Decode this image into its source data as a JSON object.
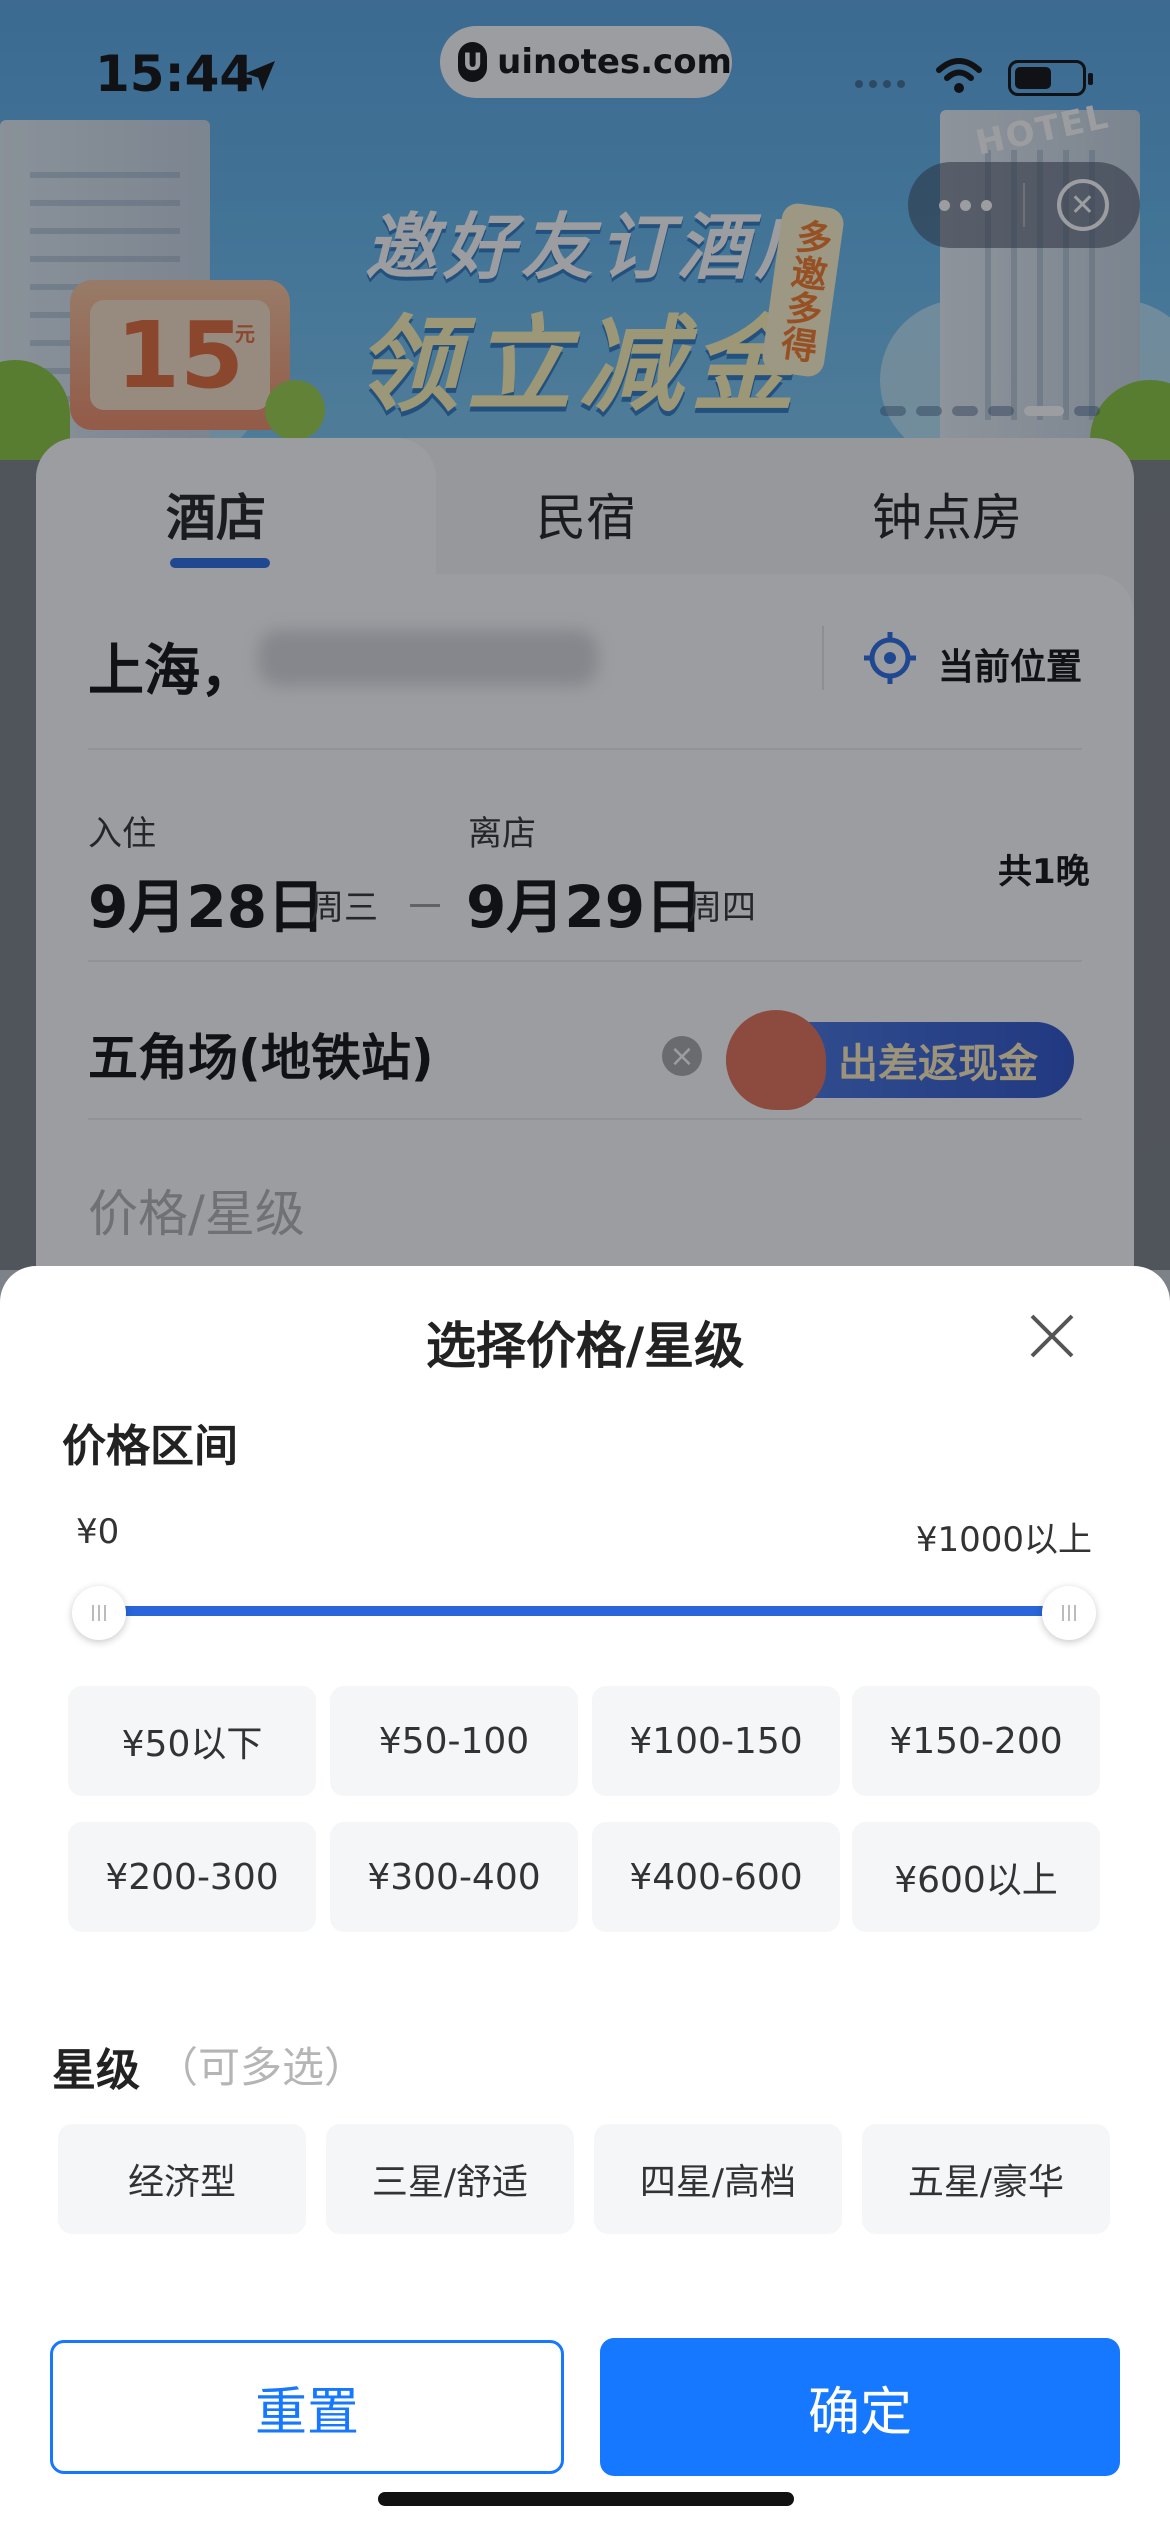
{
  "status_bar": {
    "time": "15:44",
    "url": "uinotes.com",
    "url_logo": "U"
  },
  "banner": {
    "promo_line1": "邀好友订酒店",
    "promo_line2": "领立减金",
    "promo_tag": "多邀多得",
    "coupon_value": "15",
    "coupon_unit": "元",
    "hotel_sign": "HOTEL"
  },
  "capsule": {
    "close_glyph": "✕"
  },
  "tabs": [
    "酒店",
    "民宿",
    "钟点房"
  ],
  "search": {
    "city": "上海，",
    "current_location": "当前位置",
    "checkin_label": "入住",
    "checkin_date": "9月28日",
    "checkin_week": "周三",
    "checkout_label": "离店",
    "checkout_date": "9月29日",
    "checkout_week": "周四",
    "nights": "共1晚",
    "poi": "五角场(地铁站)",
    "cashback_badge": "出差返现金",
    "price_placeholder": "价格/星级"
  },
  "sheet": {
    "title": "选择价格/星级",
    "price_section_title": "价格区间",
    "price_min_label": "¥0",
    "price_max_label": "¥1000以上",
    "slider_range": [
      0,
      1000
    ],
    "price_chips": [
      "¥50以下",
      "¥50-100",
      "¥100-150",
      "¥150-200",
      "¥200-300",
      "¥300-400",
      "¥400-600",
      "¥600以上"
    ],
    "star_section_title": "星级",
    "star_hint": "（可多选）",
    "star_chips": [
      "经济型",
      "三星/舒适",
      "四星/高档",
      "五星/豪华"
    ],
    "reset_label": "重置",
    "confirm_label": "确定"
  },
  "colors": {
    "accent": "#1677ff",
    "slider": "#2a65d9",
    "chip_bg": "#f5f6f8"
  }
}
